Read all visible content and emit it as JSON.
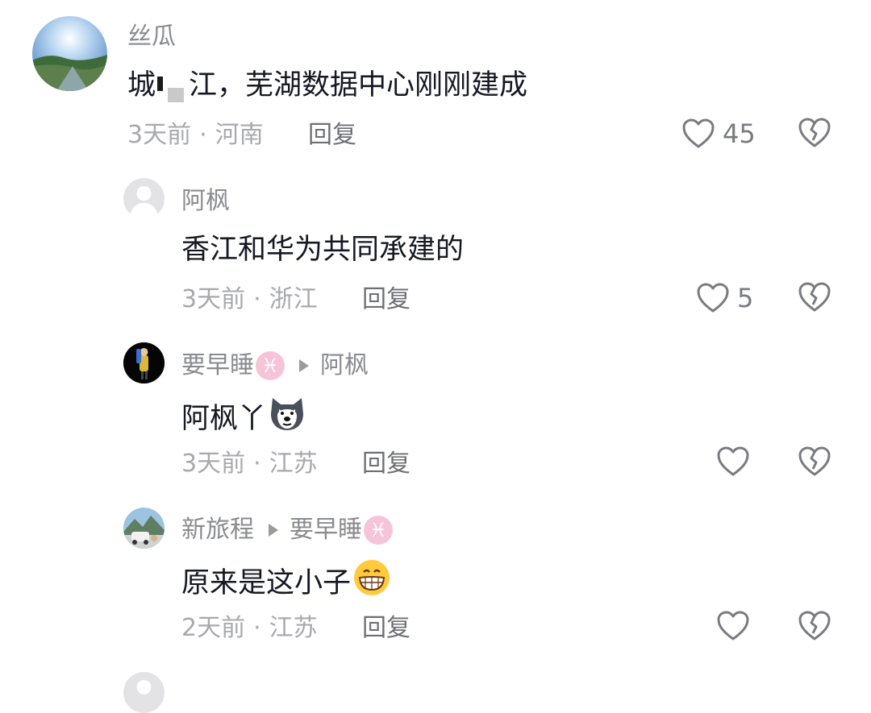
{
  "comments": [
    {
      "user": "丝瓜",
      "text_parts": [
        "城",
        "江，芜湖数据中心刚刚建成"
      ],
      "time": "3天前",
      "location": "河南",
      "reply_label": "回复",
      "likes": "45"
    },
    {
      "user": "阿枫",
      "text": "香江和华为共同承建的",
      "time": "3天前",
      "location": "浙江",
      "reply_label": "回复",
      "likes": "5"
    },
    {
      "user": "要早睡",
      "zodiac": "♓",
      "reply_to": "阿枫",
      "text": "阿枫丫",
      "emoji": "husky-dog-emoji",
      "time": "3天前",
      "location": "江苏",
      "reply_label": "回复",
      "likes": ""
    },
    {
      "user": "新旅程",
      "reply_to": "要早睡",
      "reply_to_zodiac": "♓",
      "text": "原来是这小子",
      "emoji": "grinning-face-emoji",
      "time": "2天前",
      "location": "江苏",
      "reply_label": "回复",
      "likes": ""
    }
  ],
  "separator": "·",
  "icons": {
    "like": "heart-outline-icon",
    "dislike": "broken-heart-icon"
  },
  "colors": {
    "username": "#8a8b91",
    "meta": "#a8a9ad",
    "text": "#161823",
    "zodiac_bg": "#f6c4d8"
  }
}
